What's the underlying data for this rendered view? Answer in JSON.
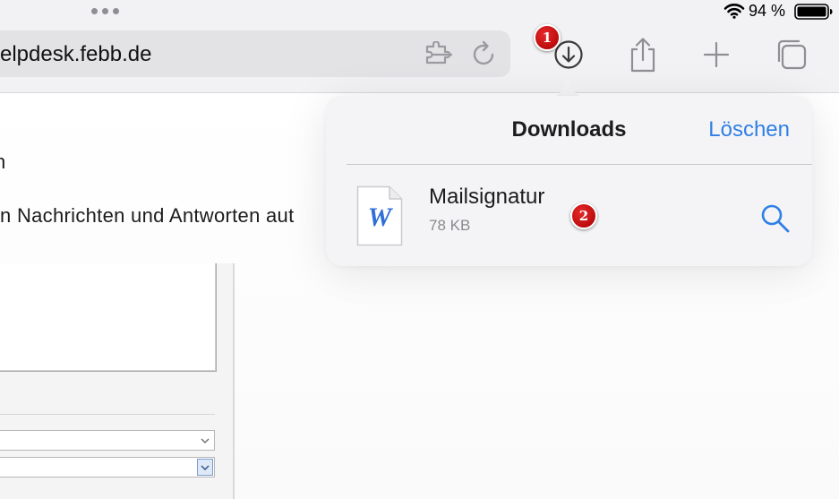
{
  "status_bar": {
    "battery_percent": "94 %",
    "icons": [
      "multitask-dots-icon",
      "wifi-icon",
      "battery-icon"
    ]
  },
  "toolbar": {
    "url": "elpdesk.febb.de",
    "icons": [
      "extension-icon",
      "reload-icon",
      "download-arrow-icon",
      "share-icon",
      "plus-icon",
      "tabs-icon"
    ]
  },
  "markers": {
    "first": "1",
    "second": "2"
  },
  "page": {
    "heading": "n",
    "description": "n Nachrichten und Antworten aut"
  },
  "downloads_popover": {
    "title": "Downloads",
    "clear_label": "Löschen",
    "items": [
      {
        "name": "Mailsignatur",
        "size": "78 KB",
        "file_icon_letter": "W",
        "icon": "word-document-icon",
        "action_icon": "magnifier-icon"
      }
    ]
  },
  "colors": {
    "accent": "#2f7fe6",
    "marker_red": "#c90d0d",
    "toolbar_bg": "#f2f2f4",
    "popover_bg": "#f4f4f6"
  }
}
